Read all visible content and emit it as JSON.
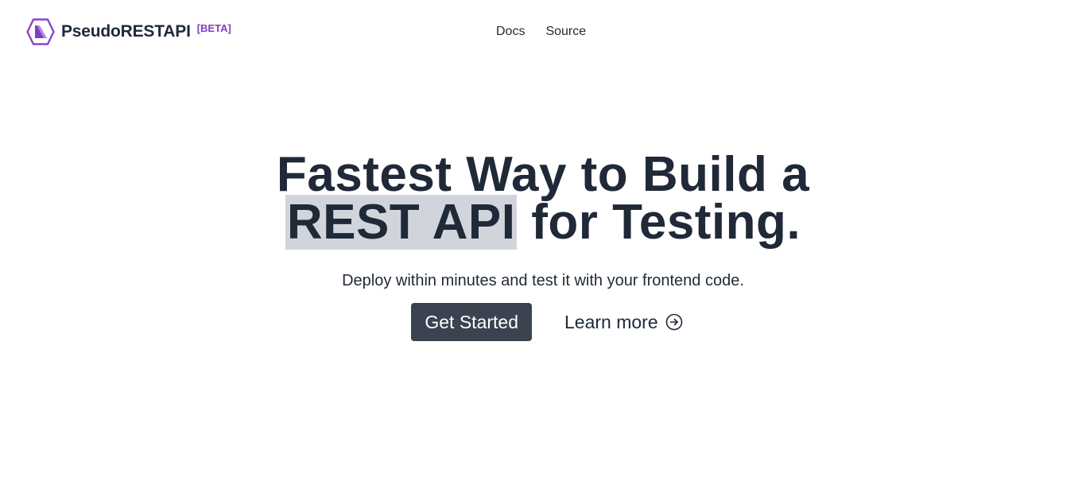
{
  "header": {
    "brand_name": "PseudoRESTAPI",
    "badge": "[BETA]",
    "logo_icon": "hexagon-logo-icon",
    "brand_color": "#7e3fbf",
    "nav": [
      {
        "label": "Docs"
      },
      {
        "label": "Source"
      }
    ]
  },
  "hero": {
    "title_line1": "Fastest Way to Build a",
    "title_highlight": "REST API",
    "title_line2_rest": " for Testing.",
    "subtitle": "Deploy within minutes and test it with your frontend code.",
    "primary_button": "Get Started",
    "secondary_link": "Learn more",
    "secondary_icon": "arrow-right-circle-icon",
    "primary_button_color": "#3b4250",
    "highlight_color": "#d1d5db"
  }
}
